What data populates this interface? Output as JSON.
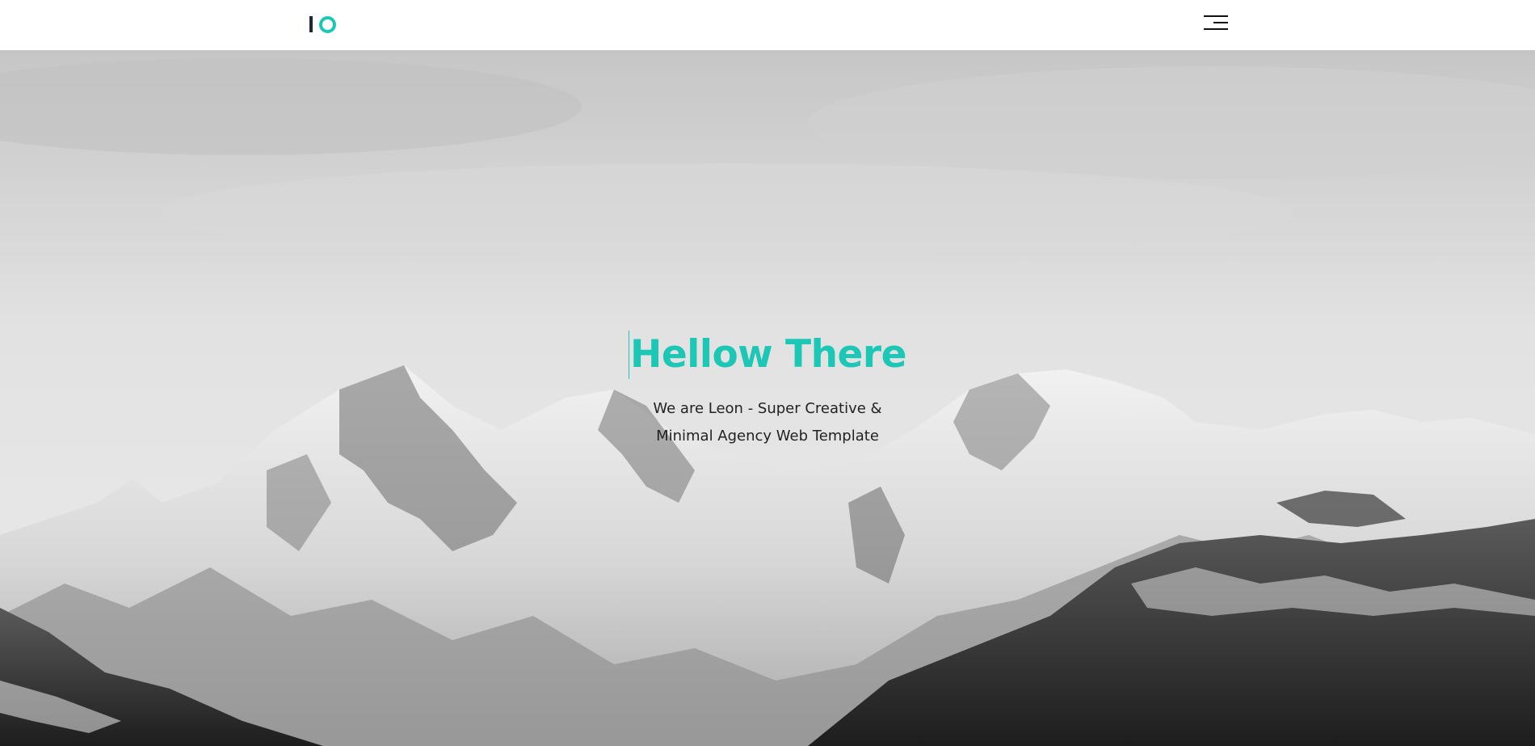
{
  "brand": {
    "accent_color": "#1cc8b5",
    "logo_icon": "logo-mark-icon"
  },
  "navbar": {
    "menu_icon": "hamburger-menu-icon"
  },
  "hero": {
    "title": "Hellow There",
    "subtitle": "We are Leon - Super Creative & Minimal Agency Web Template",
    "background_image": "snowy-mountain-range-grayscale"
  }
}
